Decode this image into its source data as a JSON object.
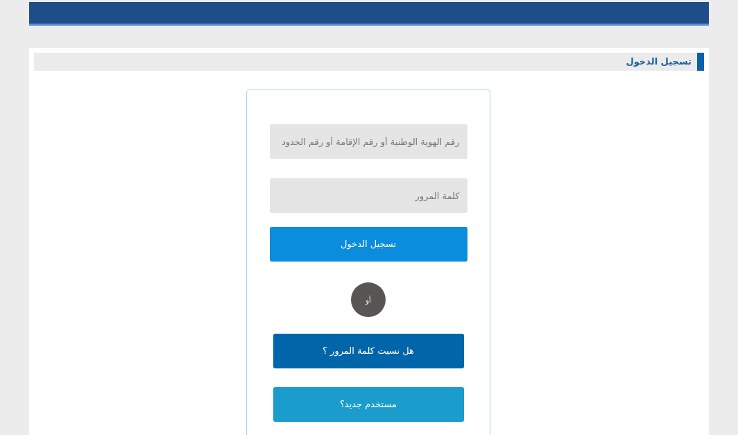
{
  "panel": {
    "title": "تسجيل الدخول"
  },
  "login_form": {
    "fields": [
      {
        "placeholder": "رقم الهوية الوطنية أو رقم الإقامة أو رقم الحدود"
      },
      {
        "placeholder": "كلمة المرور"
      }
    ],
    "submit_button": "تسجيل الدخول",
    "separator": "أو",
    "links": [
      {
        "label": "هل نسيت كلمة المرور ؟",
        "color": "#0065a9"
      },
      {
        "label": "مستخدم جديد؟",
        "color": "#1a9ccc"
      }
    ]
  }
}
